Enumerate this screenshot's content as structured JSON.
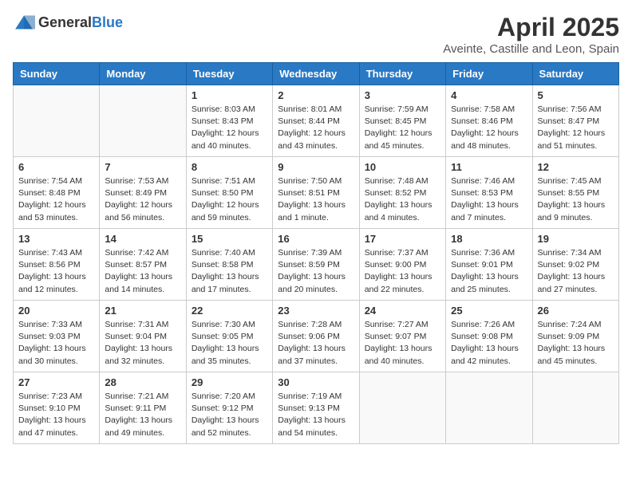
{
  "logo": {
    "general": "General",
    "blue": "Blue"
  },
  "title": "April 2025",
  "subtitle": "Aveinte, Castille and Leon, Spain",
  "days_of_week": [
    "Sunday",
    "Monday",
    "Tuesday",
    "Wednesday",
    "Thursday",
    "Friday",
    "Saturday"
  ],
  "weeks": [
    [
      {
        "day": "",
        "info": ""
      },
      {
        "day": "",
        "info": ""
      },
      {
        "day": "1",
        "info": "Sunrise: 8:03 AM\nSunset: 8:43 PM\nDaylight: 12 hours and 40 minutes."
      },
      {
        "day": "2",
        "info": "Sunrise: 8:01 AM\nSunset: 8:44 PM\nDaylight: 12 hours and 43 minutes."
      },
      {
        "day": "3",
        "info": "Sunrise: 7:59 AM\nSunset: 8:45 PM\nDaylight: 12 hours and 45 minutes."
      },
      {
        "day": "4",
        "info": "Sunrise: 7:58 AM\nSunset: 8:46 PM\nDaylight: 12 hours and 48 minutes."
      },
      {
        "day": "5",
        "info": "Sunrise: 7:56 AM\nSunset: 8:47 PM\nDaylight: 12 hours and 51 minutes."
      }
    ],
    [
      {
        "day": "6",
        "info": "Sunrise: 7:54 AM\nSunset: 8:48 PM\nDaylight: 12 hours and 53 minutes."
      },
      {
        "day": "7",
        "info": "Sunrise: 7:53 AM\nSunset: 8:49 PM\nDaylight: 12 hours and 56 minutes."
      },
      {
        "day": "8",
        "info": "Sunrise: 7:51 AM\nSunset: 8:50 PM\nDaylight: 12 hours and 59 minutes."
      },
      {
        "day": "9",
        "info": "Sunrise: 7:50 AM\nSunset: 8:51 PM\nDaylight: 13 hours and 1 minute."
      },
      {
        "day": "10",
        "info": "Sunrise: 7:48 AM\nSunset: 8:52 PM\nDaylight: 13 hours and 4 minutes."
      },
      {
        "day": "11",
        "info": "Sunrise: 7:46 AM\nSunset: 8:53 PM\nDaylight: 13 hours and 7 minutes."
      },
      {
        "day": "12",
        "info": "Sunrise: 7:45 AM\nSunset: 8:55 PM\nDaylight: 13 hours and 9 minutes."
      }
    ],
    [
      {
        "day": "13",
        "info": "Sunrise: 7:43 AM\nSunset: 8:56 PM\nDaylight: 13 hours and 12 minutes."
      },
      {
        "day": "14",
        "info": "Sunrise: 7:42 AM\nSunset: 8:57 PM\nDaylight: 13 hours and 14 minutes."
      },
      {
        "day": "15",
        "info": "Sunrise: 7:40 AM\nSunset: 8:58 PM\nDaylight: 13 hours and 17 minutes."
      },
      {
        "day": "16",
        "info": "Sunrise: 7:39 AM\nSunset: 8:59 PM\nDaylight: 13 hours and 20 minutes."
      },
      {
        "day": "17",
        "info": "Sunrise: 7:37 AM\nSunset: 9:00 PM\nDaylight: 13 hours and 22 minutes."
      },
      {
        "day": "18",
        "info": "Sunrise: 7:36 AM\nSunset: 9:01 PM\nDaylight: 13 hours and 25 minutes."
      },
      {
        "day": "19",
        "info": "Sunrise: 7:34 AM\nSunset: 9:02 PM\nDaylight: 13 hours and 27 minutes."
      }
    ],
    [
      {
        "day": "20",
        "info": "Sunrise: 7:33 AM\nSunset: 9:03 PM\nDaylight: 13 hours and 30 minutes."
      },
      {
        "day": "21",
        "info": "Sunrise: 7:31 AM\nSunset: 9:04 PM\nDaylight: 13 hours and 32 minutes."
      },
      {
        "day": "22",
        "info": "Sunrise: 7:30 AM\nSunset: 9:05 PM\nDaylight: 13 hours and 35 minutes."
      },
      {
        "day": "23",
        "info": "Sunrise: 7:28 AM\nSunset: 9:06 PM\nDaylight: 13 hours and 37 minutes."
      },
      {
        "day": "24",
        "info": "Sunrise: 7:27 AM\nSunset: 9:07 PM\nDaylight: 13 hours and 40 minutes."
      },
      {
        "day": "25",
        "info": "Sunrise: 7:26 AM\nSunset: 9:08 PM\nDaylight: 13 hours and 42 minutes."
      },
      {
        "day": "26",
        "info": "Sunrise: 7:24 AM\nSunset: 9:09 PM\nDaylight: 13 hours and 45 minutes."
      }
    ],
    [
      {
        "day": "27",
        "info": "Sunrise: 7:23 AM\nSunset: 9:10 PM\nDaylight: 13 hours and 47 minutes."
      },
      {
        "day": "28",
        "info": "Sunrise: 7:21 AM\nSunset: 9:11 PM\nDaylight: 13 hours and 49 minutes."
      },
      {
        "day": "29",
        "info": "Sunrise: 7:20 AM\nSunset: 9:12 PM\nDaylight: 13 hours and 52 minutes."
      },
      {
        "day": "30",
        "info": "Sunrise: 7:19 AM\nSunset: 9:13 PM\nDaylight: 13 hours and 54 minutes."
      },
      {
        "day": "",
        "info": ""
      },
      {
        "day": "",
        "info": ""
      },
      {
        "day": "",
        "info": ""
      }
    ]
  ]
}
